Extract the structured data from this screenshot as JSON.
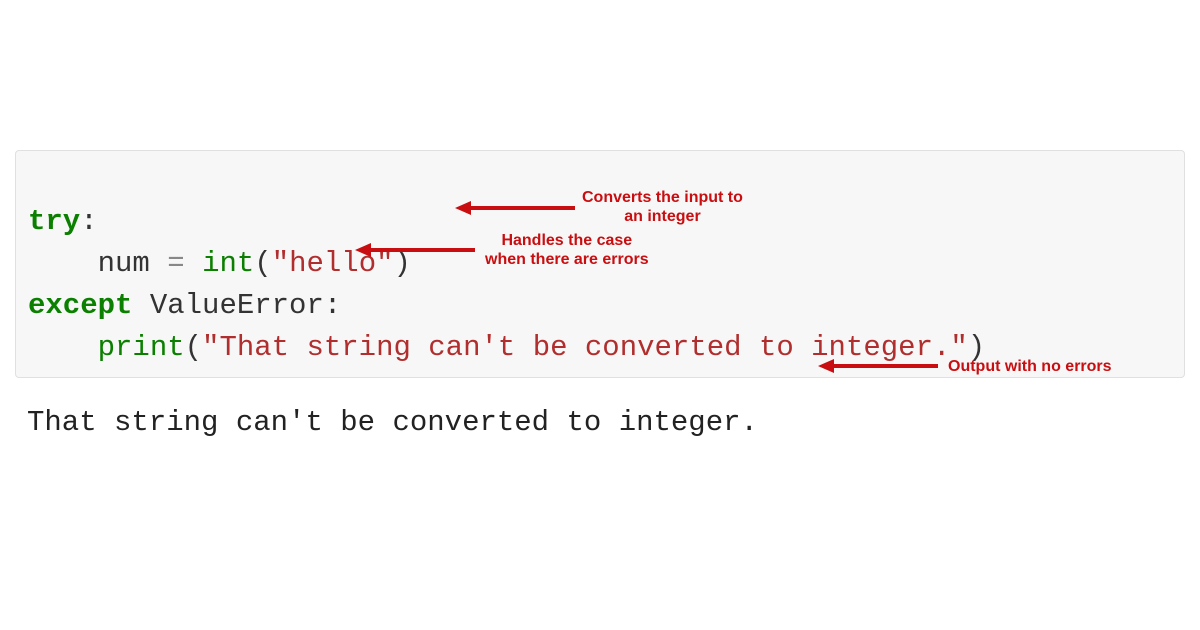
{
  "code": {
    "line1": {
      "try_kw": "try",
      "colon": ":"
    },
    "line2": {
      "indent": "    ",
      "var": "num",
      "eq": " = ",
      "func": "int",
      "lparen": "(",
      "arg": "\"hello\"",
      "rparen": ")"
    },
    "line3": {
      "except_kw": "except",
      "space": " ",
      "err": "ValueError",
      "colon": ":"
    },
    "line4": {
      "indent": "    ",
      "func": "print",
      "lparen": "(",
      "msg": "\"That string can't be converted to integer.\"",
      "rparen": ")"
    }
  },
  "output": "That string can't be converted to integer.",
  "annotations": {
    "a1": "Converts the input to\nan integer",
    "a2": "Handles the case\nwhen there are errors",
    "a3": "Output with no errors"
  }
}
